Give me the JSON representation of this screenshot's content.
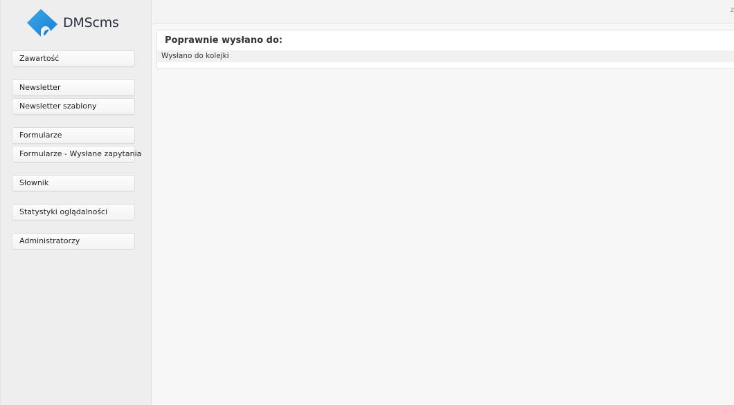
{
  "logo": {
    "text": "DMScms"
  },
  "sidebar": {
    "items": [
      {
        "label": "Zawartość"
      },
      {
        "label": "Newsletter"
      },
      {
        "label": "Newsletter szablony"
      },
      {
        "label": "Formularze"
      },
      {
        "label": "Formularze - Wysłane zapytania"
      },
      {
        "label": "Słownik"
      },
      {
        "label": "Statystyki oglądalności"
      },
      {
        "label": "Administratorzy"
      }
    ]
  },
  "topbar": {
    "right_text": "z"
  },
  "panel": {
    "title": "Poprawnie wysłano do:",
    "message": "Wysłano do kolejki"
  }
}
